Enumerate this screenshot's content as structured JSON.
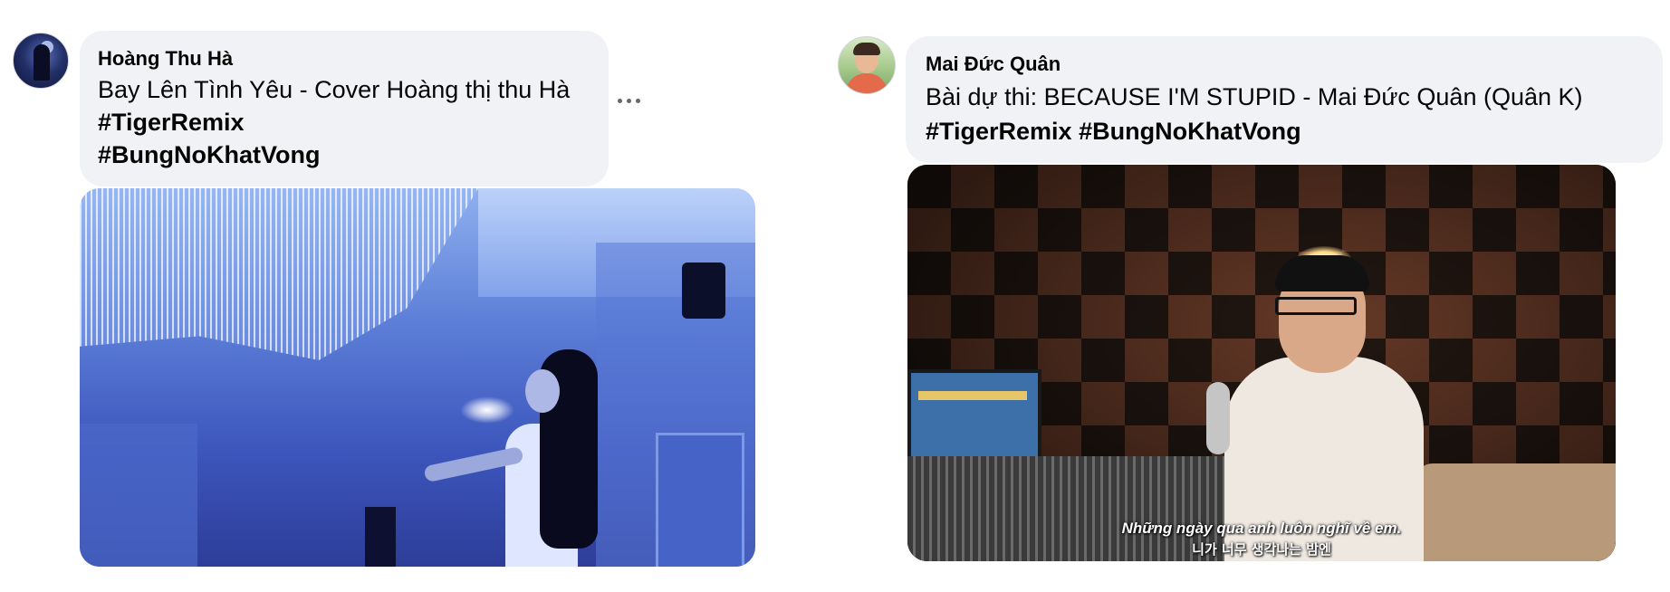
{
  "posts": [
    {
      "author": "Hoàng Thu Hà",
      "text": "Bay Lên Tình Yêu - Cover Hoàng thị thu Hà",
      "hashtags": [
        "#TigerRemix",
        "#BungNoKhatVong"
      ],
      "more_icon": "more-horizontal-icon"
    },
    {
      "author": "Mai Đức Quân",
      "text": "Bài dự thi: BECAUSE I'M STUPID - Mai Đức Quân (Quân K)",
      "hashtags": [
        "#TigerRemix",
        "#BungNoKhatVong"
      ],
      "subtitle_line1": "Những ngày qua anh luôn nghĩ về em.",
      "subtitle_line2": "니가 너무 생각나는 밤엔"
    }
  ],
  "colors": {
    "bubble_bg": "#f0f2f5",
    "text": "#050505",
    "icon": "#65676b"
  }
}
